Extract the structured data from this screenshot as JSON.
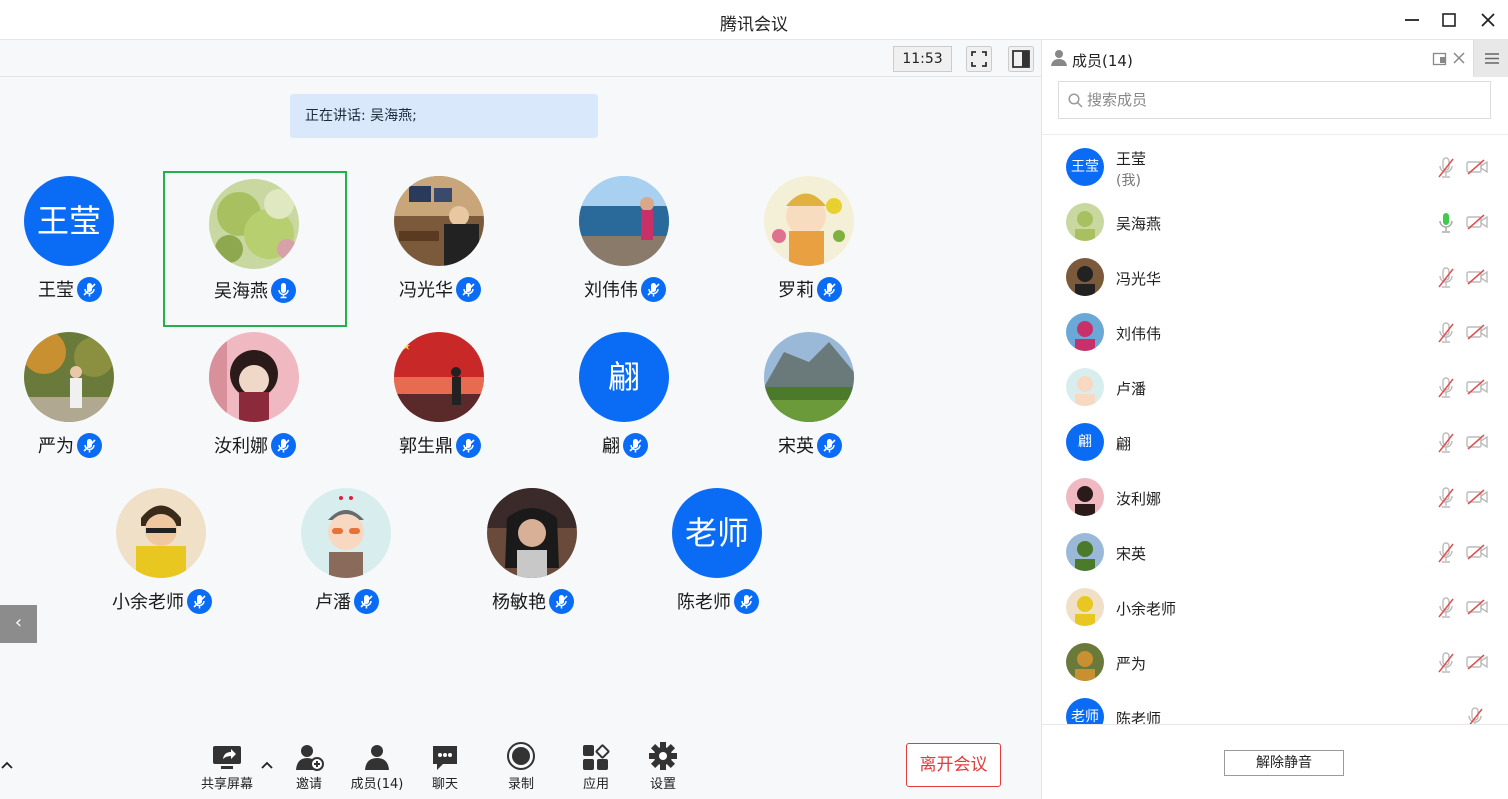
{
  "window": {
    "title": "腾讯会议"
  },
  "meeting": {
    "time": "11:53",
    "speaking": "正在讲话: 吴海燕;"
  },
  "tiles": [
    {
      "name": "王莹",
      "avatar_text": "王莹"
    },
    {
      "name": "吴海燕",
      "active": true
    },
    {
      "name": "冯光华"
    },
    {
      "name": "刘伟伟"
    },
    {
      "name": "罗莉"
    },
    {
      "name": "严为"
    },
    {
      "name": "汝利娜"
    },
    {
      "name": "郭生鼎"
    },
    {
      "name": "翩",
      "avatar_text": "翩"
    },
    {
      "name": "宋英"
    },
    {
      "name": "小余老师"
    },
    {
      "name": "卢潘"
    },
    {
      "name": "杨敏艳"
    },
    {
      "name": "陈老师",
      "avatar_text": "老师"
    }
  ],
  "toolbar": {
    "share_screen": "共享屏幕",
    "invite": "邀请",
    "members": "成员(14)",
    "chat": "聊天",
    "record": "录制",
    "apps": "应用",
    "settings": "设置",
    "leave": "离开会议"
  },
  "panel": {
    "title": "成员(14)",
    "search_placeholder": "搜索成员",
    "unmute_all": "解除静音",
    "members": [
      {
        "name": "王莹",
        "sub": "(我)",
        "avatar_text": "王莹",
        "mic": "muted",
        "cam": "off"
      },
      {
        "name": "吴海燕",
        "mic": "speaking",
        "cam": "off"
      },
      {
        "name": "冯光华",
        "mic": "muted",
        "cam": "off"
      },
      {
        "name": "刘伟伟",
        "mic": "muted",
        "cam": "off"
      },
      {
        "name": "卢潘",
        "mic": "muted",
        "cam": "off"
      },
      {
        "name": "翩",
        "avatar_text": "翩",
        "mic": "muted",
        "cam": "off"
      },
      {
        "name": "汝利娜",
        "mic": "muted",
        "cam": "off"
      },
      {
        "name": "宋英",
        "mic": "muted",
        "cam": "off"
      },
      {
        "name": "小余老师",
        "mic": "muted",
        "cam": "off"
      },
      {
        "name": "严为",
        "mic": "muted",
        "cam": "off"
      },
      {
        "name": "陈老师",
        "avatar_text": "老师",
        "mic": "muted"
      }
    ]
  },
  "colors": {
    "accent": "#0a6cf5",
    "active_border": "#22b14c",
    "leave": "#e23b3b",
    "speaking_bg": "#d9e8fb",
    "mic_on": "#3ecb4a"
  }
}
